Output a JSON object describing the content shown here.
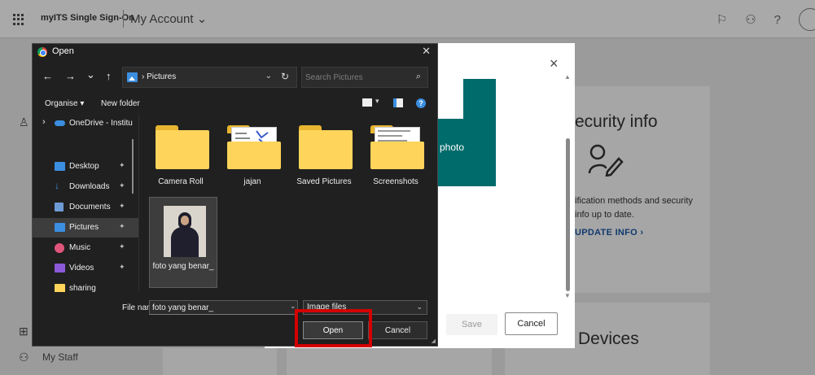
{
  "header": {
    "brand": "myITS Single Sign-On",
    "title": "My Account",
    "icons": [
      "feedback-icon",
      "org-icon",
      "help-icon",
      "avatar"
    ]
  },
  "background": {
    "security_card": {
      "title": "ecurity info",
      "description": "ification methods and security info up to date.",
      "link": "UPDATE INFO ›"
    },
    "devices_title": "Devices",
    "my_staff": "My Staff"
  },
  "photo_modal": {
    "photo_label": "photo",
    "save_label": "Save",
    "cancel_label": "Cancel",
    "close_glyph": "×"
  },
  "dialog": {
    "title": "Open",
    "close_glyph": "✕",
    "nav": {
      "back": "←",
      "forward": "→",
      "recent": "⌄",
      "up": "↑"
    },
    "address": "› Pictures",
    "search_placeholder": "Search Pictures",
    "toolbar": {
      "organise": "Organise ▾",
      "new_folder": "New folder"
    },
    "sidebar": [
      {
        "label": "OneDrive - Institu",
        "color": "#3b8ee0",
        "pinned": false,
        "selected": false,
        "expand": "›"
      },
      {
        "label": "Desktop",
        "color": "#3b8ee0",
        "pinned": true,
        "selected": false
      },
      {
        "label": "Downloads",
        "color": "#3b8ee0",
        "pinned": true,
        "selected": false
      },
      {
        "label": "Documents",
        "color": "#6d9bd6",
        "pinned": true,
        "selected": false
      },
      {
        "label": "Pictures",
        "color": "#3b8ee0",
        "pinned": true,
        "selected": true
      },
      {
        "label": "Music",
        "color": "#e0557a",
        "pinned": true,
        "selected": false
      },
      {
        "label": "Videos",
        "color": "#8c5ad8",
        "pinned": true,
        "selected": false
      },
      {
        "label": "sharing",
        "color": "#ffd45a",
        "pinned": false,
        "selected": false
      }
    ],
    "files": [
      {
        "name": "Camera Roll",
        "kind": "folder"
      },
      {
        "name": "jajan",
        "kind": "folder-doc"
      },
      {
        "name": "Saved Pictures",
        "kind": "folder"
      },
      {
        "name": "Screenshots",
        "kind": "folder-doc"
      },
      {
        "name": "foto yang benar_",
        "kind": "image",
        "selected": true
      }
    ],
    "file_name_label": "File name:",
    "file_name_value": "foto yang benar_",
    "file_type": "Image files",
    "open_label": "Open",
    "cancel_label": "Cancel"
  },
  "colors": {
    "highlight": "#d40000",
    "accent": "#3b8ee0",
    "teal": "#006b6b"
  }
}
